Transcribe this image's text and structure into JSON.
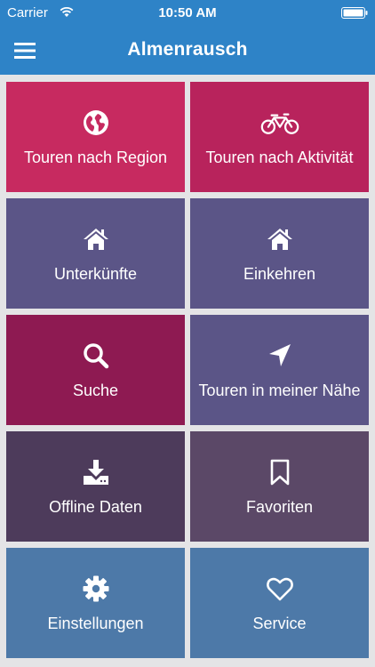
{
  "status_bar": {
    "carrier": "Carrier",
    "time": "10:50 AM"
  },
  "nav": {
    "title": "Almenrausch",
    "menu_icon": "hamburger-menu-icon"
  },
  "tiles": [
    {
      "label": "Touren nach Region",
      "icon": "globe-icon",
      "color": "#c72a60"
    },
    {
      "label": "Touren nach Aktivität",
      "icon": "bicycle-icon",
      "color": "#b8235c"
    },
    {
      "label": "Unterkünfte",
      "icon": "home-icon",
      "color": "#5b5587"
    },
    {
      "label": "Einkehren",
      "icon": "home-icon",
      "color": "#5b5587"
    },
    {
      "label": "Suche",
      "icon": "search-icon",
      "color": "#8e1a52"
    },
    {
      "label": "Touren in meiner Nähe",
      "icon": "location-arrow-icon",
      "color": "#5b5587"
    },
    {
      "label": "Offline Daten",
      "icon": "download-icon",
      "color": "#4d3b5b"
    },
    {
      "label": "Favoriten",
      "icon": "bookmark-icon",
      "color": "#5b4867"
    },
    {
      "label": "Einstellungen",
      "icon": "gear-icon",
      "color": "#4d79a8"
    },
    {
      "label": "Service",
      "icon": "heart-icon",
      "color": "#4d79a8"
    }
  ]
}
